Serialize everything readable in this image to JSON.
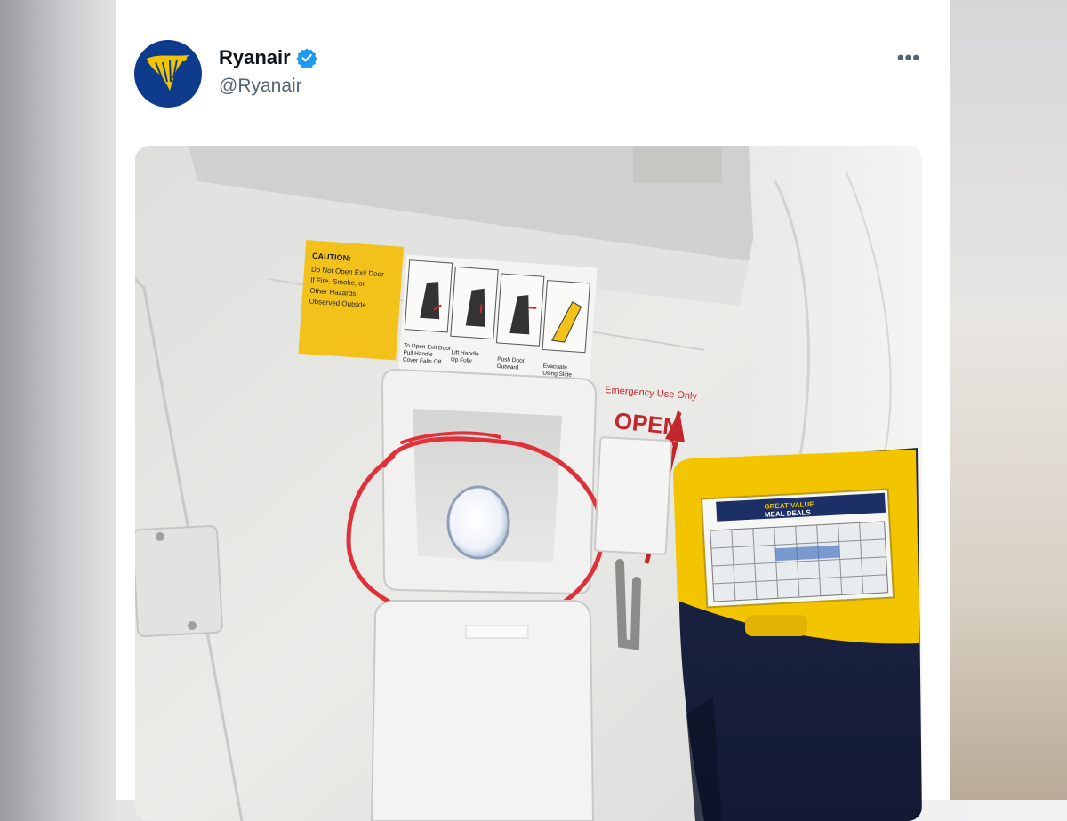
{
  "post": {
    "author_name": "Ryanair",
    "handle": "@Ryanair",
    "more_label": "•••"
  },
  "photo": {
    "caution_label": "CAUTION:",
    "caution_lines": [
      "Do Not Open Exit Door",
      "If Fire, Smoke, or",
      "Other Hazards",
      "Observed Outside"
    ],
    "steps": [
      [
        "To Open Exit Door",
        "Pull Handle",
        "Cover Falls Off"
      ],
      [
        "Lift Handle",
        "Up Fully"
      ],
      [
        "Push Door",
        "Outward"
      ],
      [
        "Evacuate",
        "Using Slide"
      ]
    ],
    "emergency_label": "Emergency Use Only",
    "open_label": "OPEN",
    "ad_title": "GREAT VALUE",
    "ad_subtitle": "MEAL DEALS"
  },
  "colors": {
    "brand_navy": "#0f3b8c",
    "brand_yellow": "#f2c500",
    "verified_blue": "#1d9bf0",
    "annotation_red": "#e0303a"
  },
  "icons": {
    "avatar": "ryanair-harp-logo-icon",
    "verified": "verified-badge-icon",
    "more": "more-options-icon"
  }
}
